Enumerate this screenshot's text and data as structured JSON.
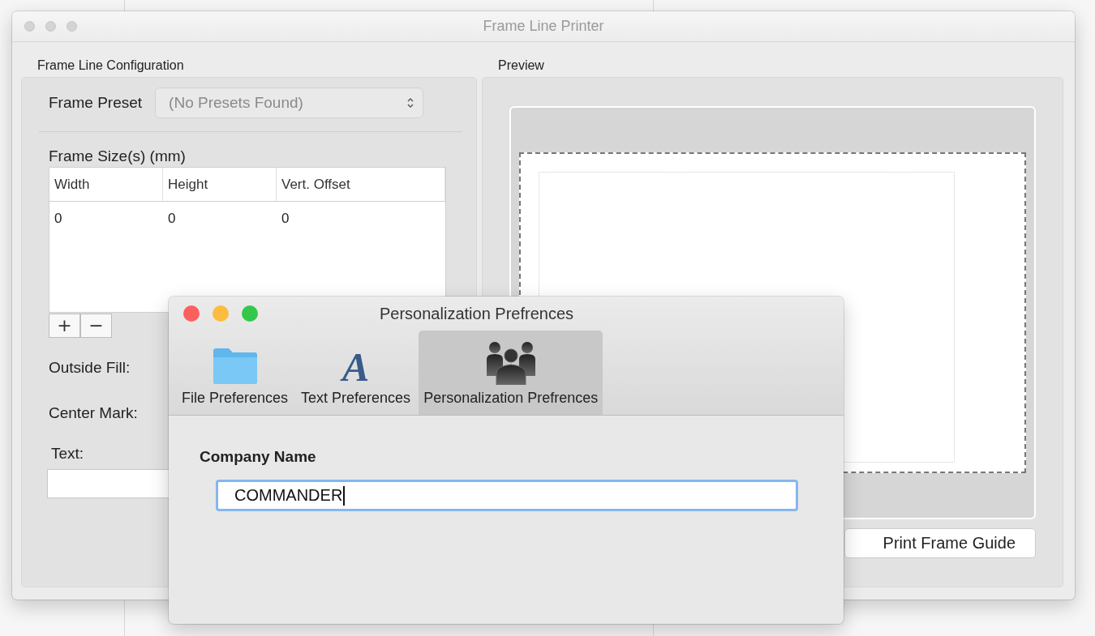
{
  "window": {
    "title": "Frame Line Printer",
    "active": false
  },
  "configuration": {
    "title": "Frame Line Configuration",
    "preset_label": "Frame Preset",
    "preset": {
      "value": "(No Presets Found)",
      "disabled": true
    },
    "sizes_label": "Frame Size(s) (mm)",
    "table": {
      "columns": [
        "Width",
        "Height",
        "Vert. Offset"
      ],
      "rows": [
        [
          "0",
          "0",
          "0"
        ]
      ]
    },
    "add_button": "+",
    "remove_button": "−",
    "outside_fill_label": "Outside Fill:",
    "center_mark_label": "Center Mark:",
    "text_label": "Text:"
  },
  "preview": {
    "title": "Preview",
    "print_button": "Print Frame Guide"
  },
  "dialog": {
    "title": "Personalization Prefrences",
    "active": true,
    "tabs": [
      {
        "label": "File Preferences",
        "kind": "folder",
        "selected": false
      },
      {
        "label": "Text Preferences",
        "kind": "glyph",
        "glyph": "A",
        "selected": false
      },
      {
        "label": "Personalization Prefrences",
        "kind": "people",
        "selected": true
      }
    ],
    "field_label": "Company Name",
    "field_value": "COMMANDER",
    "focused": true
  }
}
